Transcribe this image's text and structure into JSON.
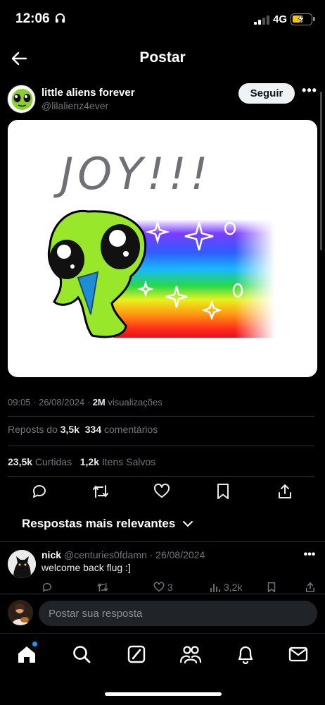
{
  "status_bar": {
    "time": "12:06",
    "network": "4G"
  },
  "header": {
    "title": "Postar"
  },
  "post": {
    "author_name": "little aliens forever",
    "author_handle": "@lilalienz4ever",
    "follow_label": "Seguir",
    "image_text": "JOY!!!",
    "timestamp": "09:05 · 26/08/2024 · ",
    "views_count": "2M",
    "views_label": " visualizações",
    "reposts_label": "Reposts do ",
    "reposts_count": "3,5k",
    "comments_count": "334",
    "comments_label": " comentários",
    "likes_count": "23,5k",
    "likes_label": " Curtidas",
    "saves_count": "1,2k",
    "saves_label": " Itens Salvos"
  },
  "replies": {
    "filter_label": "Respostas mais relevantes",
    "items": [
      {
        "name": "nick",
        "handle_date": "@centuries0fdamn · 26/08/2024",
        "text": "welcome back flug :]",
        "likes": "3",
        "views": "3,2k"
      }
    ]
  },
  "compose": {
    "placeholder": "Postar sua resposta"
  },
  "tab_bar": {
    "tabs": [
      "home-icon",
      "search-icon",
      "grok-icon",
      "communities-icon",
      "notifications-icon",
      "messages-icon"
    ]
  },
  "colors": {
    "accent": "#1d9bf0",
    "muted": "#71767b",
    "background": "#000000"
  }
}
